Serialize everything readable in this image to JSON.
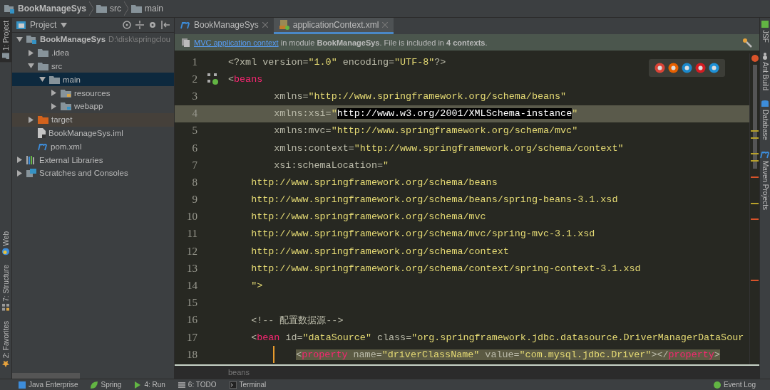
{
  "breadcrumbs": [
    {
      "label": "BookManageSys",
      "kind": "module"
    },
    {
      "label": "src",
      "kind": "folder"
    },
    {
      "label": "main",
      "kind": "folder"
    }
  ],
  "left_stripe": [
    {
      "label": "1: Project",
      "selected": true,
      "kind": "project"
    },
    {
      "label": "Web",
      "selected": false,
      "kind": "web"
    },
    {
      "label": "7: Structure",
      "selected": false,
      "kind": "structure"
    },
    {
      "label": "2: Favorites",
      "selected": false,
      "kind": "favorites"
    }
  ],
  "project_panel": {
    "title": "Project",
    "tree": [
      {
        "label": "BookManageSys",
        "path": "D:\\disk\\springclou",
        "kind": "module",
        "expanded": true,
        "selected": false,
        "children": [
          {
            "label": ".idea",
            "kind": "folder",
            "expanded": false,
            "selected": false
          },
          {
            "label": "src",
            "kind": "folder",
            "expanded": true,
            "selected": false,
            "children": [
              {
                "label": "main",
                "kind": "folder",
                "expanded": true,
                "selected": true,
                "children": [
                  {
                    "label": "resources",
                    "kind": "resources",
                    "expanded": false,
                    "selected": false
                  },
                  {
                    "label": "webapp",
                    "kind": "web",
                    "expanded": false,
                    "selected": false
                  }
                ]
              }
            ]
          },
          {
            "label": "target",
            "kind": "excluded",
            "expanded": false,
            "selected": false
          },
          {
            "label": "BookManageSys.iml",
            "kind": "file",
            "selected": false
          },
          {
            "label": "pom.xml",
            "kind": "maven",
            "selected": false
          }
        ]
      },
      {
        "label": "External Libraries",
        "kind": "libraries",
        "expanded": false,
        "selected": false
      },
      {
        "label": "Scratches and Consoles",
        "kind": "scratches",
        "expanded": false,
        "selected": false
      }
    ]
  },
  "tabs": [
    {
      "label": "BookManageSys",
      "kind": "maven",
      "selected": false
    },
    {
      "label": "applicationContext.xml",
      "kind": "xml",
      "selected": true
    }
  ],
  "notification": {
    "link": "MVC application context",
    "text": " in module **BookManageSys**. File is included in **4 contexts**."
  },
  "editor": {
    "lines": [
      {
        "number": "1",
        "current": false,
        "tokens": [
          {
            "kind": "plain",
            "text": "<?xml version="
          },
          {
            "kind": "value",
            "text": "\"1.0\""
          },
          {
            "kind": "plain",
            "text": " encoding="
          },
          {
            "kind": "value",
            "text": "\"UTF-8\""
          },
          {
            "kind": "plain",
            "text": "?>"
          }
        ]
      },
      {
        "number": "2",
        "current": false,
        "tokens": [
          {
            "kind": "plain",
            "text": "<"
          },
          {
            "kind": "tag",
            "text": "beans"
          }
        ]
      },
      {
        "number": "3",
        "current": false,
        "tokens": [
          {
            "kind": "plain",
            "text": "        xmlns="
          },
          {
            "kind": "value",
            "text": "\"http://www.springframework.org/schema/beans\""
          }
        ]
      },
      {
        "number": "4",
        "current": true,
        "tokens": [
          {
            "kind": "plain",
            "text": "        xmlns:xsi="
          },
          {
            "kind": "value",
            "text": "\""
          },
          {
            "kind": "selected",
            "text": "http://www.w3.org/2001/XMLSchema-instance"
          },
          {
            "kind": "value",
            "text": "\""
          }
        ]
      },
      {
        "number": "5",
        "current": false,
        "tokens": [
          {
            "kind": "plain",
            "text": "        xmlns:mvc="
          },
          {
            "kind": "value",
            "text": "\"http://www.springframework.org/schema/mvc\""
          }
        ]
      },
      {
        "number": "6",
        "current": false,
        "tokens": [
          {
            "kind": "plain",
            "text": "        xmlns:context="
          },
          {
            "kind": "value",
            "text": "\"http://www.springframework.org/schema/context\""
          }
        ]
      },
      {
        "number": "7",
        "current": false,
        "tokens": [
          {
            "kind": "plain",
            "text": "        xsi:schemaLocation="
          },
          {
            "kind": "value",
            "text": "\""
          }
        ]
      },
      {
        "number": "8",
        "current": false,
        "tokens": [
          {
            "kind": "value",
            "text": "    http://www.springframework.org/schema/beans"
          }
        ]
      },
      {
        "number": "9",
        "current": false,
        "tokens": [
          {
            "kind": "value",
            "text": "    http://www.springframework.org/schema/beans/spring-beans-3.1.xsd"
          }
        ]
      },
      {
        "number": "10",
        "current": false,
        "tokens": [
          {
            "kind": "value",
            "text": "    http://www.springframework.org/schema/mvc"
          }
        ]
      },
      {
        "number": "11",
        "current": false,
        "tokens": [
          {
            "kind": "value",
            "text": "    http://www.springframework.org/schema/mvc/spring-mvc-3.1.xsd"
          }
        ]
      },
      {
        "number": "12",
        "current": false,
        "tokens": [
          {
            "kind": "value",
            "text": "    http://www.springframework.org/schema/context"
          }
        ]
      },
      {
        "number": "13",
        "current": false,
        "tokens": [
          {
            "kind": "value",
            "text": "    http://www.springframework.org/schema/context/spring-context-3.1.xsd"
          }
        ]
      },
      {
        "number": "14",
        "current": false,
        "tokens": [
          {
            "kind": "value",
            "text": "    \">"
          }
        ]
      },
      {
        "number": "15",
        "current": false
      },
      {
        "number": "16",
        "current": false,
        "tokens": [
          {
            "kind": "plain",
            "text": "    <!-- 配置数据源-->"
          }
        ]
      },
      {
        "number": "17",
        "current": false,
        "tokens": [
          {
            "kind": "plain",
            "text": "    <"
          },
          {
            "kind": "tag",
            "text": "bean"
          },
          {
            "kind": "plain",
            "text": " id="
          },
          {
            "kind": "value",
            "text": "\"dataSource\""
          },
          {
            "kind": "plain",
            "text": " class="
          },
          {
            "kind": "value",
            "text": "\"org.springframework.jdbc.datasource.DriverManagerDataSour"
          }
        ]
      },
      {
        "number": "18",
        "current": false,
        "guide": true,
        "tokens": [
          {
            "kind": "match",
            "text": "<"
          },
          {
            "kind": "matchtag",
            "text": "property"
          },
          {
            "kind": "matchplain",
            "text": " name="
          },
          {
            "kind": "matchvalue",
            "text": "\"driverClassName\""
          },
          {
            "kind": "matchplain",
            "text": " value="
          },
          {
            "kind": "matchvalue",
            "text": "\"com.mysql.jdbc.Driver\""
          },
          {
            "kind": "match",
            "text": "></"
          },
          {
            "kind": "matchtag",
            "text": "property"
          },
          {
            "kind": "match",
            "text": ">"
          }
        ]
      }
    ],
    "breadcrumb": "beans"
  },
  "right_stripe": [
    {
      "label": "JSF",
      "kind": "jsf"
    },
    {
      "label": "Ant Build",
      "kind": "ant"
    },
    {
      "label": "Database",
      "kind": "database"
    },
    {
      "label": "Maven Projects",
      "kind": "maven"
    }
  ],
  "bottom_bar": [
    {
      "label": "Java Enterprise",
      "kind": "java"
    },
    {
      "label": "Spring",
      "kind": "spring"
    },
    {
      "label": "4: Run",
      "kind": "run"
    },
    {
      "label": "6: TODO",
      "kind": "todo"
    },
    {
      "label": "Terminal",
      "kind": "terminal"
    }
  ],
  "event_log": "Event Log"
}
